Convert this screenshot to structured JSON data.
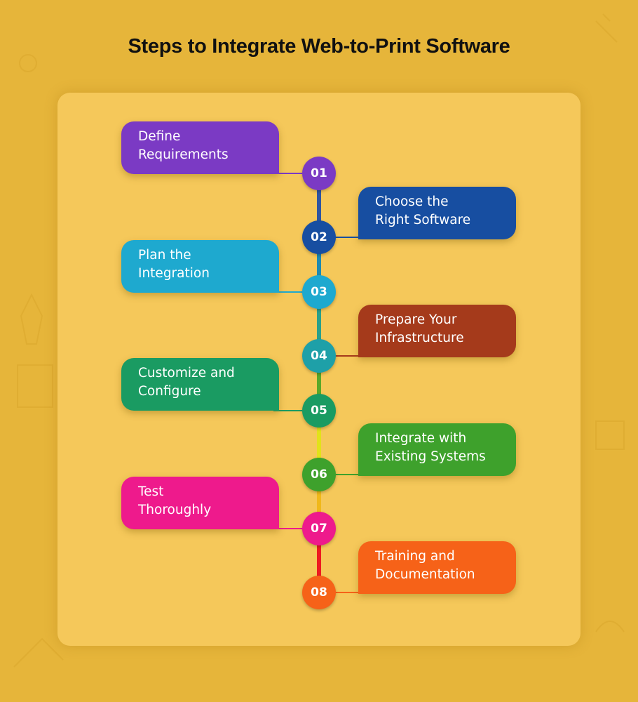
{
  "title": "Steps to Integrate Web-to-Print Software",
  "colors": {
    "background": "#e6b53a",
    "card": "#f5c85a"
  },
  "steps": [
    {
      "number": "01",
      "line1": "Define",
      "line2": "Requirements",
      "side": "left",
      "color": "#7b3ac4"
    },
    {
      "number": "02",
      "line1": "Choose the",
      "line2": "Right Software",
      "side": "right",
      "color": "#174ea1"
    },
    {
      "number": "03",
      "line1": "Plan the",
      "line2": "Integration",
      "side": "left",
      "color": "#1ea9cf"
    },
    {
      "number": "04",
      "line1": "Prepare Your",
      "line2": "Infrastructure",
      "side": "right",
      "color": "#a53a1b"
    },
    {
      "number": "05",
      "line1": "Customize and",
      "line2": "Configure",
      "side": "left",
      "color": "#1a9b62"
    },
    {
      "number": "06",
      "line1": "Integrate with",
      "line2": "Existing Systems",
      "side": "right",
      "color": "#3ea12c"
    },
    {
      "number": "07",
      "line1": "Test",
      "line2": "Thoroughly",
      "side": "left",
      "color": "#ee1a8c"
    },
    {
      "number": "08",
      "line1": "Training and",
      "line2": "Documentation",
      "side": "right",
      "color": "#f66218"
    }
  ],
  "node_colors": [
    "#7b3ac4",
    "#174ea1",
    "#1ea9cf",
    "#1ea0a8",
    "#1a9b62",
    "#3ea12c",
    "#ee1a8c",
    "#f66218"
  ],
  "spine_colors": [
    "#2f55a0",
    "#1e8ab0",
    "#2aa08a",
    "#5aa82a",
    "#e2e21a",
    "#f0b81a",
    "#ee1a20"
  ]
}
